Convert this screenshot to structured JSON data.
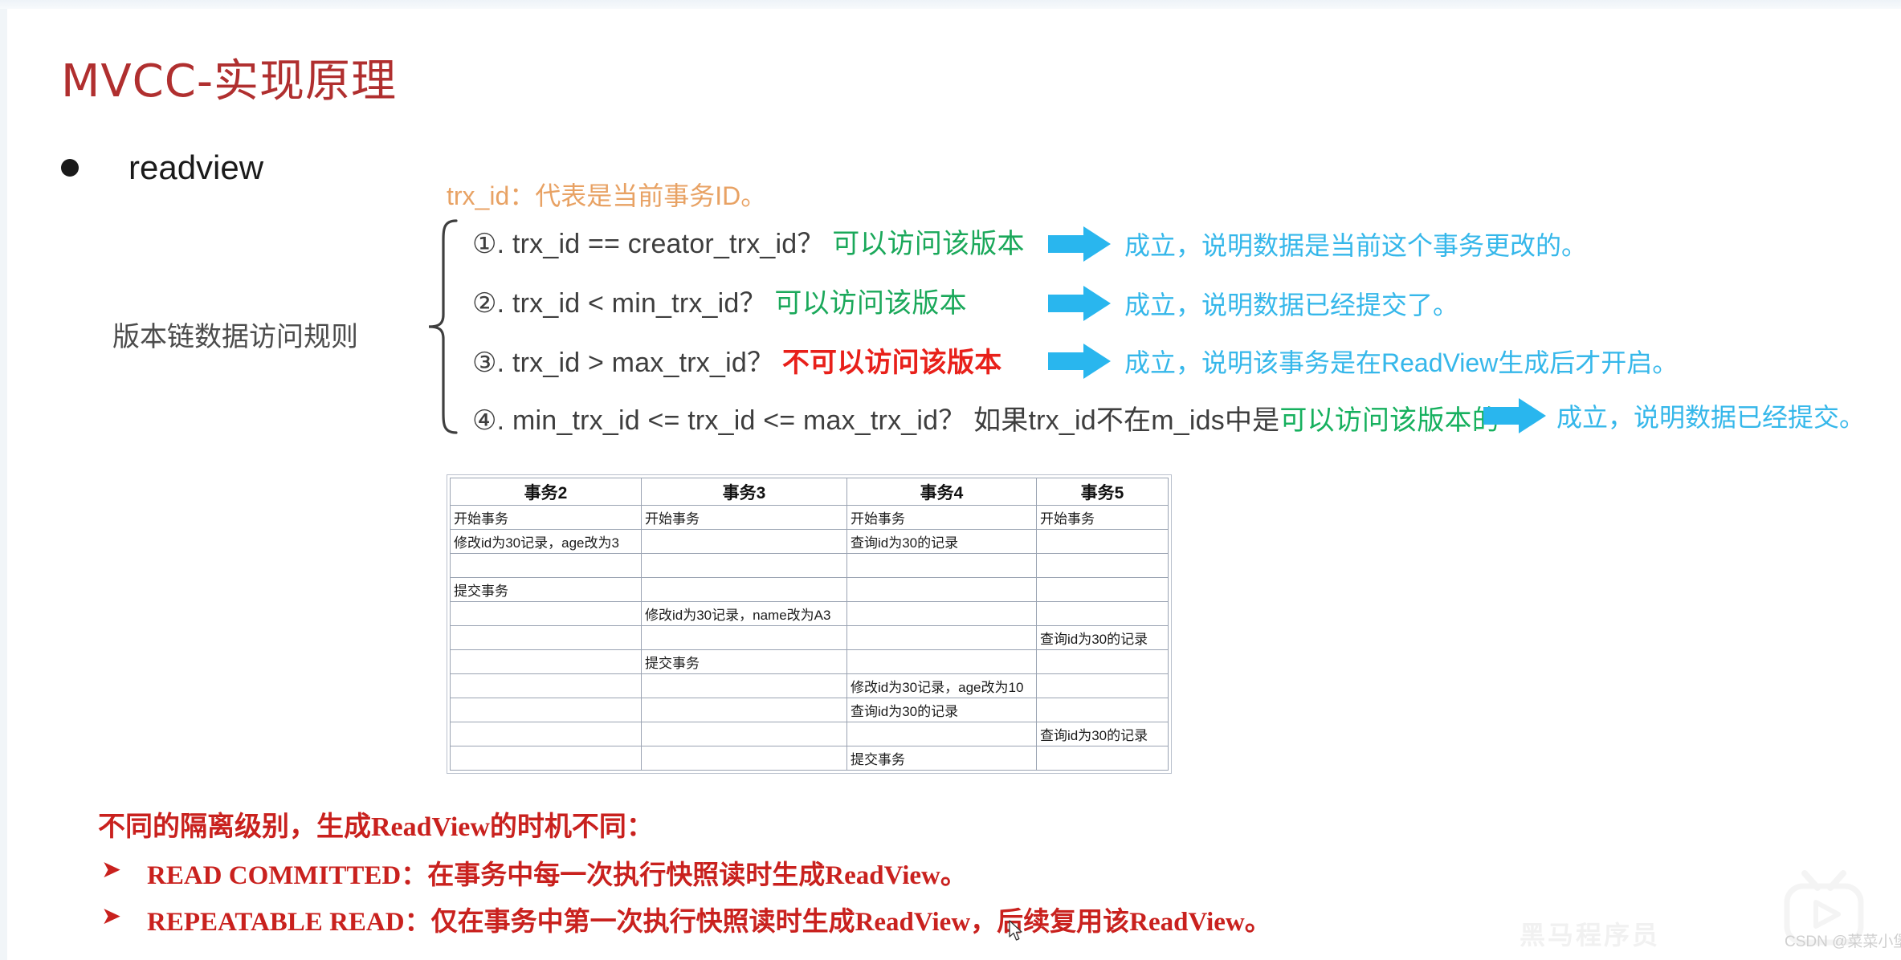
{
  "slide": {
    "title": "MVCC-实现原理",
    "bullet_label": "readview",
    "bullet_icon": "bullet-dot"
  },
  "rules_section": {
    "trx_note": "trx_id：代表是当前事务ID。",
    "group_label": "版本链数据访问规则",
    "rules": [
      {
        "number": "①.",
        "condition": "trx_id  == creator_trx_id？",
        "verdict": "可以访问该版本",
        "verdict_color": "#1aa85a",
        "verdict_type": "allow",
        "conclusion": "成立，说明数据是当前这个事务更改的。"
      },
      {
        "number": "②.",
        "condition": "trx_id < min_trx_id？",
        "verdict": "可以访问该版本",
        "verdict_color": "#1aa85a",
        "verdict_type": "allow",
        "conclusion": "成立，说明数据已经提交了。"
      },
      {
        "number": "③.",
        "condition": "trx_id > max_trx_id？",
        "verdict": "不可以访问该版本",
        "verdict_color": "#e8201a",
        "verdict_type": "deny",
        "conclusion": "成立，说明该事务是在ReadView生成后才开启。"
      },
      {
        "number": "④.",
        "condition": "min_trx_id <= trx_id <= max_trx_id？",
        "condition_extra": "如果trx_id不在m_ids中是",
        "verdict": "可以访问该版本的",
        "verdict_color": "#16b05e",
        "verdict_type": "allow",
        "conclusion": "成立，说明数据已经提交。"
      }
    ],
    "arrow_color": "#29b6ee",
    "conclusion_color": "#35b7ea"
  },
  "transaction_table": {
    "headers": [
      "事务2",
      "事务3",
      "事务4",
      "事务5"
    ],
    "rows": [
      [
        "开始事务",
        "开始事务",
        "开始事务",
        "开始事务"
      ],
      [
        "修改id为30记录，age改为3",
        "",
        "查询id为30的记录",
        ""
      ],
      [
        "",
        "",
        "",
        ""
      ],
      [
        "提交事务",
        "",
        "",
        ""
      ],
      [
        "",
        "修改id为30记录，name改为A3",
        "",
        ""
      ],
      [
        "",
        "",
        "",
        "查询id为30的记录"
      ],
      [
        "",
        "提交事务",
        "",
        ""
      ],
      [
        "",
        "",
        "修改id为30记录，age改为10",
        ""
      ],
      [
        "",
        "",
        "查询id为30的记录",
        ""
      ],
      [
        "",
        "",
        "",
        "查询id为30的记录"
      ],
      [
        "",
        "",
        "提交事务",
        ""
      ]
    ]
  },
  "isolation_notes": {
    "heading": "不同的隔离级别，生成ReadView的时机不同：",
    "bullet_icon": "chevron-right-icon",
    "items": [
      "READ COMMITTED：在事务中每一次执行快照读时生成ReadView。",
      "REPEATABLE READ：仅在事务中第一次执行快照读时生成ReadView，后续复用该ReadView。"
    ],
    "color": "#c9211e"
  },
  "watermark": {
    "brand_text": "黑马程序员",
    "logo_icon": "bilibili-tv-icon",
    "attribution": "CSDN @菜菜小堡"
  }
}
